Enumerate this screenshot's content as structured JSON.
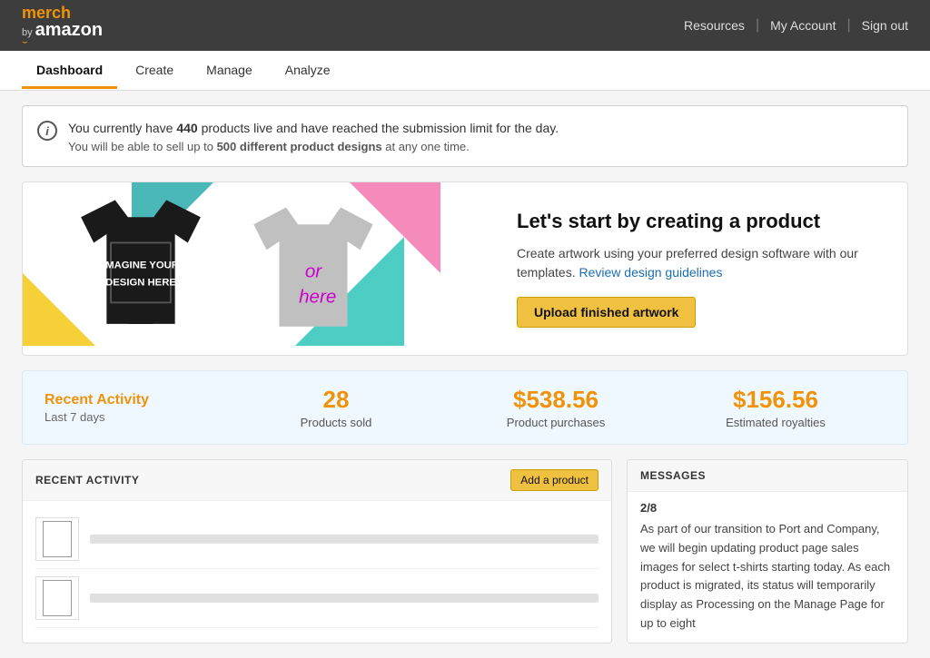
{
  "header": {
    "logo_merch": "merch",
    "logo_by": "by",
    "logo_amazon": "amazon",
    "logo_smile": "⌣",
    "nav_resources": "Resources",
    "nav_my_account": "My Account",
    "nav_sign_out": "Sign out"
  },
  "nav_tabs": {
    "tabs": [
      {
        "label": "Dashboard",
        "active": true
      },
      {
        "label": "Create",
        "active": false
      },
      {
        "label": "Manage",
        "active": false
      },
      {
        "label": "Analyze",
        "active": false
      }
    ]
  },
  "alert": {
    "message_prefix": "You currently have ",
    "count": "440",
    "message_suffix": " products live and have reached the submission limit for the day.",
    "sub_prefix": "You will be able to sell up to ",
    "sub_count": "500 different product designs",
    "sub_suffix": " at any one time."
  },
  "hero": {
    "title": "Let's start by creating a product",
    "description": "Create artwork using your preferred design software with our templates.",
    "link_text": "Review design guidelines",
    "button_label": "Upload finished artwork",
    "tshirt_black_text1": "IMAGINE YOUR",
    "tshirt_black_text2": "DESIGN HERE",
    "tshirt_gray_text": "or here"
  },
  "stats": {
    "section_title": "Recent Activity",
    "period_label": "Last 7 days",
    "items": [
      {
        "value": "28",
        "label": "Products sold"
      },
      {
        "value": "$538.56",
        "label": "Product purchases"
      },
      {
        "value": "$156.56",
        "label": "Estimated royalties"
      }
    ]
  },
  "recent_activity": {
    "header_title": "RECENT ACTIVITY",
    "add_button": "Add a product"
  },
  "messages": {
    "header_title": "MESSAGES",
    "date": "2/8",
    "body": "As part of our transition to Port and Company, we will begin updating product page sales images for select t-shirts starting today. As each product is migrated, its status will temporarily display as Processing on the Manage Page for up to eight"
  }
}
